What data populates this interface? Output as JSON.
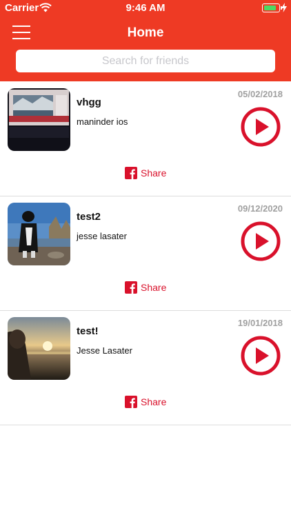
{
  "status_bar": {
    "carrier": "Carrier",
    "time": "9:46 AM"
  },
  "header": {
    "title": "Home"
  },
  "search": {
    "placeholder": "Search for friends"
  },
  "colors": {
    "header_bg": "#ee3a24",
    "accent_red": "#d9112b",
    "date_gray": "#a0a0a0"
  },
  "videos": [
    {
      "title": "vhgg",
      "user": "maninder ios",
      "date": "05/02/2018",
      "share_label": "Share"
    },
    {
      "title": "test2",
      "user": "jesse lasater",
      "date": "09/12/2020",
      "share_label": "Share"
    },
    {
      "title": "test!",
      "user": "Jesse Lasater",
      "date": "19/01/2018",
      "share_label": "Share"
    }
  ]
}
